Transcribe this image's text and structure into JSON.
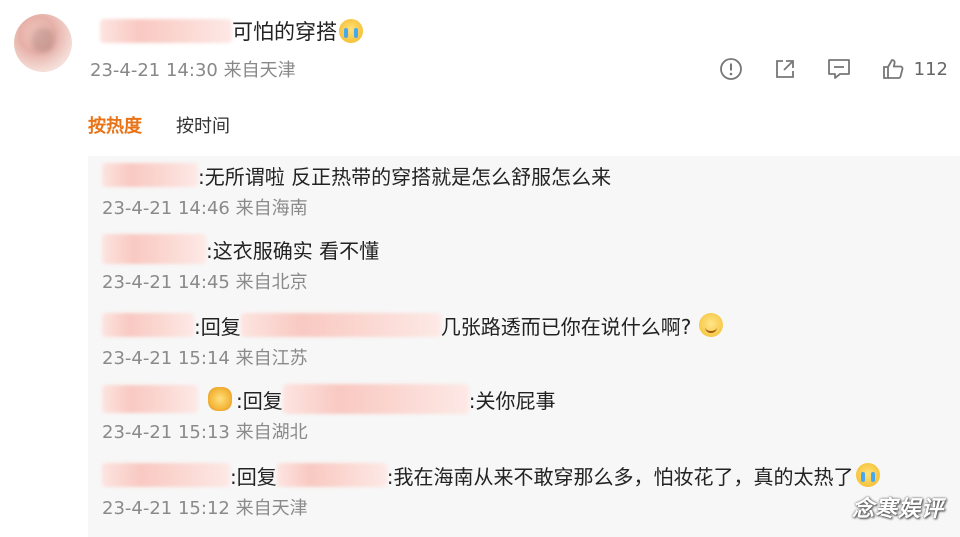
{
  "post": {
    "text": "可怕的穿搭",
    "meta": "23-4-21 14:30 来自天津",
    "like_count": "112"
  },
  "icons": {
    "report": "report-icon",
    "share": "share-icon",
    "comment": "comment-icon",
    "like": "thumbs-up-icon"
  },
  "sort_tabs": [
    "按热度",
    "按时间"
  ],
  "replies": [
    {
      "prefix": "",
      "text": ":无所谓啦 反正热带的穿搭就是怎么舒服怎么来",
      "meta": "23-4-21 14:46 来自海南"
    },
    {
      "prefix": "",
      "text": ":这衣服确实  看不懂",
      "meta": "23-4-21 14:45 来自北京"
    },
    {
      "prefix": ":回复",
      "text": "几张路透而已你在说什么啊?",
      "meta": "23-4-21 15:14 来自江苏"
    },
    {
      "prefix": ":回复",
      "text": ":关你屁事",
      "meta": "23-4-21 15:13 来自湖北"
    },
    {
      "prefix": ":回复",
      "text": ":我在海南从来不敢穿那么多，怕妆花了，真的太热了",
      "meta": "23-4-21 15:12 来自天津"
    }
  ],
  "watermark": "念寒娱评",
  "colors": {
    "accent": "#e97418",
    "meta": "#888888",
    "panel": "#f7f7f7"
  }
}
